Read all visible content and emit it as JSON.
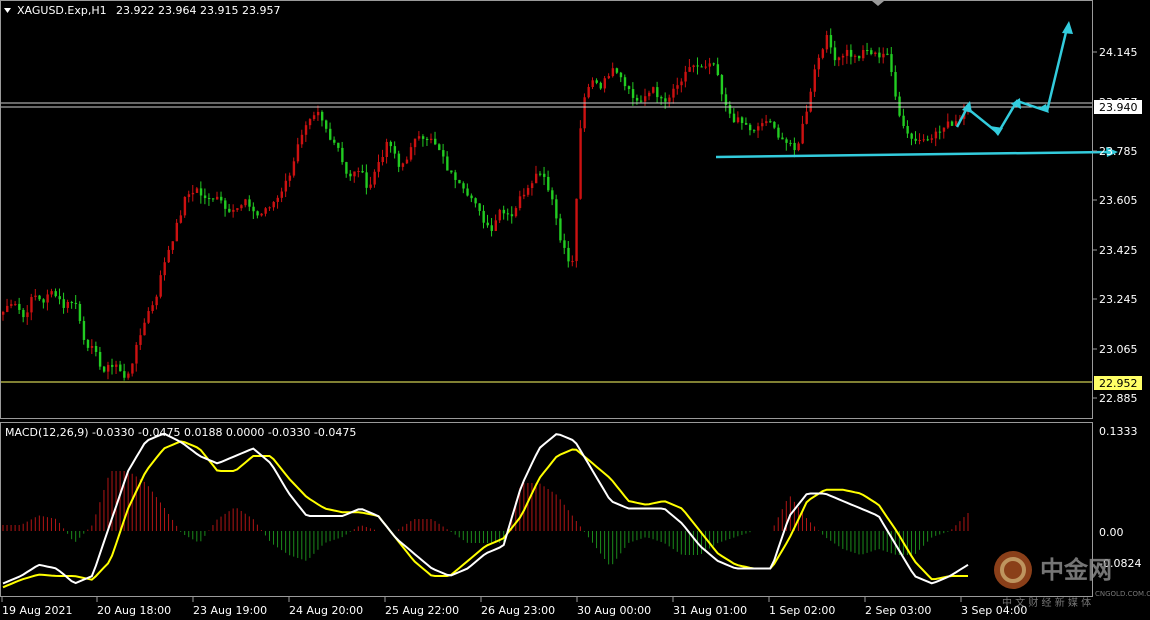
{
  "header": {
    "symbol": "XAGUSD.Exp,H1",
    "ohlc": "23.922 23.964 23.915 23.957"
  },
  "price_axis": {
    "ticks": [
      "24.145",
      "23.785",
      "23.605",
      "23.425",
      "23.245",
      "23.065",
      "22.885"
    ],
    "current_price_tag": "23.940",
    "current_price_tag_partial": "23.957",
    "support_tag": "22.952"
  },
  "macd": {
    "label": "MACD(12,26,9) -0.0330 -0.0475 0.0188 0.0000 -0.0330 -0.0475",
    "axis_ticks": [
      "0.1333",
      "0.00",
      "-0.0824"
    ]
  },
  "time_axis": {
    "labels": [
      "19 Aug 2021",
      "20 Aug 18:00",
      "23 Aug 19:00",
      "24 Aug 20:00",
      "25 Aug 22:00",
      "26 Aug 23:00",
      "30 Aug 00:00",
      "31 Aug 01:00",
      "1 Sep 02:00",
      "2 Sep 03:00",
      "3 Sep 04:00"
    ]
  },
  "watermark": {
    "brand": "中金网",
    "domain": "CNGOLD.COM.CN",
    "tagline": "中 文 财 经 新 媒 体"
  },
  "colors": {
    "bull": "#cc1111",
    "bear": "#22cc22",
    "macd_line": "#ffffff",
    "signal_line": "#ffff00",
    "level_line": "#ffff66",
    "annotation": "#33ccdd",
    "grid_border": "#9a9a9a"
  },
  "chart_data": {
    "type": "candlestick",
    "title": "XAGUSD.Exp,H1",
    "y_range": [
      22.8,
      24.28
    ],
    "horizontal_levels": [
      23.952,
      23.93,
      22.952
    ],
    "trendline": {
      "from": [
        "31 Aug 05:00",
        23.755
      ],
      "to": [
        "3 Sep 13:00",
        23.775
      ]
    },
    "projection_path": [
      23.895,
      23.96,
      23.845,
      23.975,
      23.94,
      24.255
    ],
    "price_path": [
      23.2,
      23.25,
      23.18,
      23.26,
      23.24,
      23.28,
      23.22,
      23.25,
      23.1,
      23.05,
      22.98,
      23.02,
      22.95,
      23.05,
      23.18,
      23.25,
      23.4,
      23.5,
      23.62,
      23.65,
      23.6,
      23.63,
      23.58,
      23.57,
      23.6,
      23.55,
      23.57,
      23.62,
      23.68,
      23.8,
      23.88,
      23.92,
      23.85,
      23.8,
      23.68,
      23.72,
      23.65,
      23.75,
      23.82,
      23.72,
      23.78,
      23.85,
      23.83,
      23.78,
      23.7,
      23.68,
      23.62,
      23.55,
      23.5,
      23.58,
      23.55,
      23.62,
      23.68,
      23.72,
      23.62,
      23.45,
      23.35,
      23.95,
      24.05,
      24.02,
      24.1,
      24.05,
      23.98,
      23.96,
      24.02,
      23.95,
      24.0,
      24.05,
      24.1,
      24.08,
      24.1,
      23.95,
      23.9,
      23.88,
      23.85,
      23.9,
      23.86,
      23.82,
      23.78,
      23.92,
      24.1,
      24.2,
      24.12,
      24.15,
      24.12,
      24.15,
      24.13,
      24.15,
      23.95,
      23.85,
      23.82,
      23.84,
      23.85,
      23.88,
      23.9,
      23.95
    ],
    "macd_path": [
      -0.07,
      -0.06,
      -0.045,
      -0.05,
      -0.07,
      -0.06,
      0.01,
      0.08,
      0.12,
      0.13,
      0.118,
      0.1,
      0.09,
      0.1,
      0.11,
      0.09,
      0.05,
      0.02,
      0.02,
      0.02,
      0.03,
      0.02,
      -0.01,
      -0.03,
      -0.05,
      -0.06,
      -0.05,
      -0.03,
      -0.02,
      0.06,
      0.11,
      0.13,
      0.12,
      0.08,
      0.04,
      0.03,
      0.03,
      0.03,
      0.01,
      -0.02,
      -0.04,
      -0.05,
      -0.05,
      -0.05,
      0.02,
      0.05,
      0.05,
      0.04,
      0.03,
      0.02,
      -0.02,
      -0.06,
      -0.07,
      -0.06,
      -0.045
    ],
    "signal_path": [
      -0.075,
      -0.065,
      -0.058,
      -0.06,
      -0.06,
      -0.065,
      -0.04,
      0.03,
      0.08,
      0.11,
      0.12,
      0.11,
      0.08,
      0.08,
      0.1,
      0.1,
      0.07,
      0.045,
      0.03,
      0.025,
      0.025,
      0.02,
      -0.01,
      -0.04,
      -0.06,
      -0.06,
      -0.04,
      -0.02,
      -0.01,
      0.02,
      0.07,
      0.1,
      0.11,
      0.09,
      0.07,
      0.04,
      0.035,
      0.04,
      0.03,
      0.0,
      -0.03,
      -0.045,
      -0.05,
      -0.05,
      -0.01,
      0.04,
      0.055,
      0.055,
      0.05,
      0.035,
      0.0,
      -0.04,
      -0.065,
      -0.06,
      -0.06
    ],
    "macd_range": [
      -0.0824,
      0.1333
    ]
  }
}
